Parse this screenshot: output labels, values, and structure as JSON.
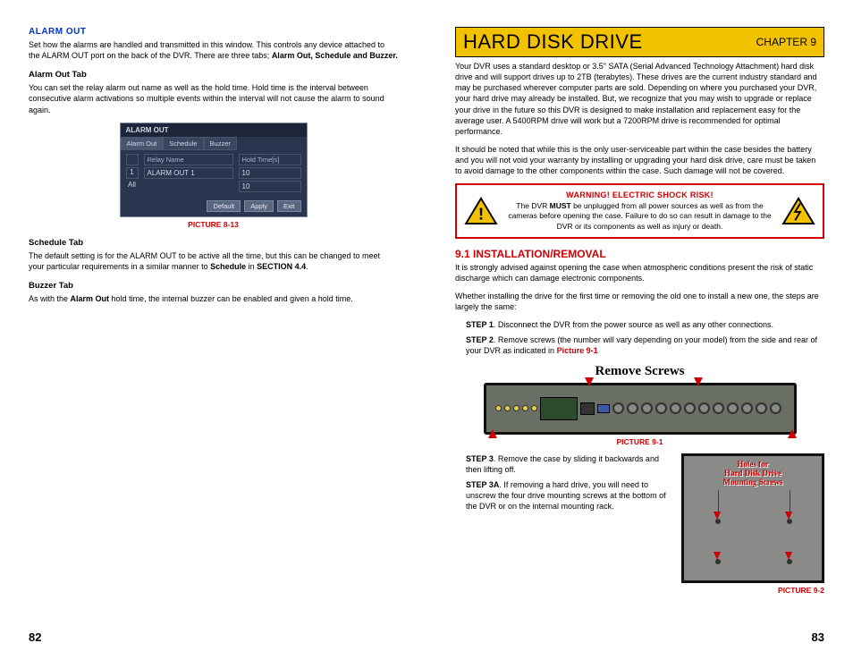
{
  "leftPage": {
    "number": "82",
    "alarmOut": {
      "title": "ALARM OUT",
      "intro": "Set how the alarms are handled and transmitted in this window. This controls any device attached to the ALARM OUT port on the back of the DVR. There are three tabs; ",
      "tabsList": "Alarm Out, Schedule and Buzzer.",
      "alarmOutTab": {
        "title": "Alarm Out Tab",
        "body": "You can set the relay alarm out name as well as the hold time. Hold time is the interval between consecutive alarm activations so multiple events within the interval will not cause the alarm to sound again."
      },
      "ui": {
        "windowTitle": "ALARM OUT",
        "tabs": [
          "Alarm Out",
          "Schedule",
          "Buzzer"
        ],
        "headers": [
          "",
          "Relay Name",
          "Hold Time[s]"
        ],
        "row1": [
          "1",
          "ALARM OUT 1",
          "10"
        ],
        "rowAll": [
          "All",
          "",
          "10"
        ],
        "buttons": [
          "Default",
          "Apply",
          "Exit"
        ]
      },
      "picCaption": "PICTURE 8-13",
      "scheduleTab": {
        "title": "Schedule Tab",
        "body1": "The default setting is for the ALARM OUT to be active all the time, but this can be changed to meet your particular requirements in a similar manner to ",
        "scheduleWord": "Schedule",
        "body2": " in ",
        "sectionRef": "SECTION 4.4",
        "body3": "."
      },
      "buzzerTab": {
        "title": "Buzzer Tab",
        "body1": "As with the ",
        "alarmOutWord": "Alarm Out",
        "body2": " hold time, the internal buzzer can be enabled and given a hold time."
      }
    }
  },
  "rightPage": {
    "number": "83",
    "chapter": {
      "title": "HARD DISK DRIVE",
      "num": "CHAPTER 9"
    },
    "intro1": "Your DVR uses a standard desktop or 3.5\" SATA (Serial Advanced Technology Attachment) hard disk drive and will support drives up to 2TB (terabytes). These drives are the current industry standard and may be purchased wherever computer parts are sold. Depending on where you purchased your DVR, your hard drive may already be installed. But, we recognize that you may wish to upgrade or replace your drive in the future so this DVR is designed to make installation and replacement easy for the average user. A 5400RPM drive will work but a 7200RPM drive is recommended for optimal performance.",
    "intro2": "It should be noted that while this is the only user-serviceable part within the case besides the battery and you will not void your warranty by installing or upgrading your hard disk drive, care must be taken to avoid damage to the other components within the case. Such damage will not be covered.",
    "warning": {
      "heading": "WARNING! ELECTRIC SHOCK RISK!",
      "body1": "The DVR ",
      "must": "MUST",
      "body2": " be unplugged from all power sources as well as from the cameras before opening the case. Failure to do so can result in damage to the DVR or its components as well as injury or death."
    },
    "section91": {
      "title": "9.1 INSTALLATION/REMOVAL",
      "p1": "It is strongly advised against opening the case when atmospheric conditions present the risk of static discharge which can damage electronic components.",
      "p2": "Whether installing the drive for the first time or removing the old one to install a new one, the steps are largely the same:",
      "step1Label": "STEP 1",
      "step1": ". Disconnect the DVR from the power source as well as any other connections.",
      "step2Label": "STEP 2",
      "step2a": ". Remove screws (the number will vary depending on your model) from the side and rear of your DVR as indicated in ",
      "step2Ref": "Picture 9-1",
      "removeTitle": "Remove Screws",
      "pic91": "PICTURE 9-1",
      "step3Label": "STEP 3",
      "step3": ". Remove the case by sliding it backwards and then lifting off.",
      "step3aLabel": "STEP 3A",
      "step3a": ". If removing a hard drive, you will need to unscrew the four drive mounting screws at the bottom of the DVR or on the internal mounting rack.",
      "driveLabel1": "Holes for",
      "driveLabel2": "Hard Disk Drive",
      "driveLabel3": "Mounting Screws",
      "pic92": "PICTURE 9-2"
    }
  }
}
